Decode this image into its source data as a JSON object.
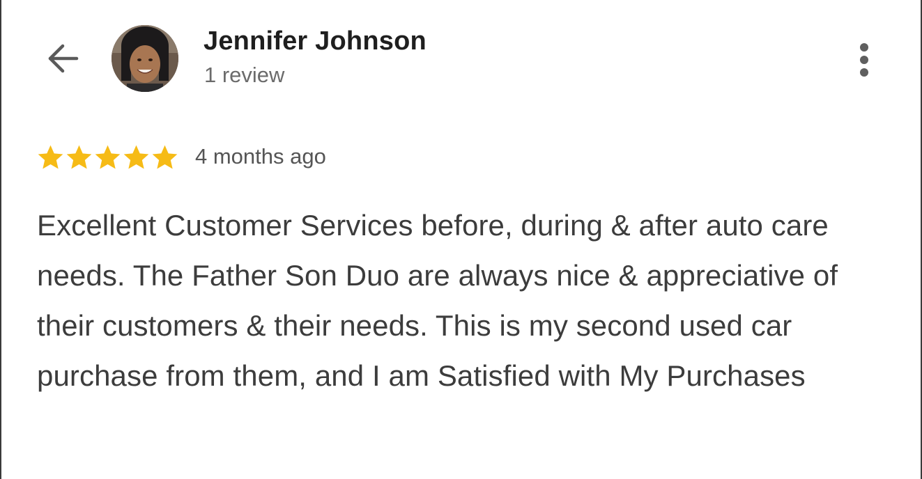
{
  "header": {
    "reviewer_name": "Jennifer Johnson",
    "review_count": "1 review",
    "back_icon": "arrow-left-icon",
    "menu_icon": "more-vertical-icon"
  },
  "review": {
    "rating": 5,
    "rating_max": 5,
    "star_color": "#F6BB16",
    "time_ago": "4 months ago",
    "text": "Excellent Customer Services before, during & after auto care needs. The Father Son Duo are always nice & appreciative of their customers & their needs. This is my second used car purchase from them, and I am Satisfied with My Purchases"
  }
}
